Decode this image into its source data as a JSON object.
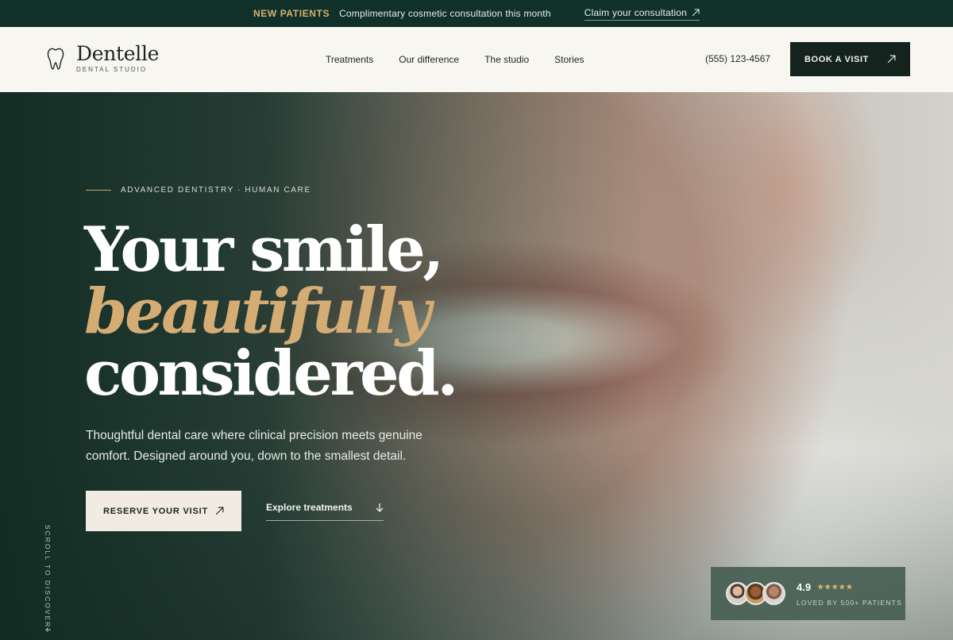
{
  "announcement": {
    "tag": "NEW PATIENTS",
    "message": "Complimentary cosmetic consultation this month",
    "link": "Claim your consultation"
  },
  "header": {
    "brand": "Dentelle",
    "subtitle": "DENTAL STUDIO",
    "nav": [
      "Treatments",
      "Our difference",
      "The studio",
      "Stories"
    ],
    "phone": "(555) 123-4567",
    "cta": "BOOK A VISIT"
  },
  "hero": {
    "eyebrow": "ADVANCED DENTISTRY · HUMAN CARE",
    "headline": [
      "Your smile,",
      "beautifully",
      "considered."
    ],
    "lede": "Thoughtful dental care where clinical precision meets genuine comfort. Designed around you, down to the smallest detail.",
    "primary_cta": "RESERVE YOUR VISIT",
    "secondary_cta": "Explore treatments",
    "scroll_hint": "SCROLL TO DISCOVER"
  },
  "rating": {
    "score": "4.9",
    "stars": "★★★★★",
    "caption": "LOVED BY 500+ PATIENTS"
  },
  "colors": {
    "accent_gold": "#d4ac74",
    "dark_green": "#14231e",
    "cream": "#f8f6f1"
  }
}
